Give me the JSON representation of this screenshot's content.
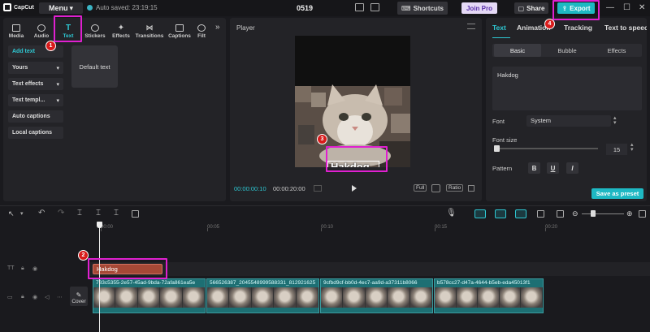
{
  "titlebar": {
    "logo": "CapCut",
    "menu_label": "Menu",
    "autosave": "Auto saved: 23:19:15",
    "project_name": "0519",
    "shortcuts_label": "Shortcuts",
    "join_pro_label": "Join Pro",
    "share_label": "Share",
    "export_label": "Export"
  },
  "left_panel": {
    "tabs": [
      {
        "label": "Media",
        "icon": "media-icon"
      },
      {
        "label": "Audio",
        "icon": "audio-icon"
      },
      {
        "label": "Text",
        "icon": "text-icon",
        "active": true
      },
      {
        "label": "Stickers",
        "icon": "stickers-icon"
      },
      {
        "label": "Effects",
        "icon": "effects-icon"
      },
      {
        "label": "Transitions",
        "icon": "transitions-icon"
      },
      {
        "label": "Captions",
        "icon": "captions-icon"
      },
      {
        "label": "Filt",
        "icon": "filters-icon"
      }
    ],
    "side_items": [
      {
        "label": "Add text",
        "active": true
      },
      {
        "label": "Yours",
        "has_dropdown": true
      },
      {
        "label": "Text effects",
        "has_dropdown": true
      },
      {
        "label": "Text templ...",
        "has_dropdown": true
      },
      {
        "label": "Auto captions"
      },
      {
        "label": "Local captions"
      }
    ],
    "default_text_card": "Default text"
  },
  "player": {
    "title": "Player",
    "overlay_text": "Hakdog",
    "current_time": "00:00:00:10",
    "total_time": "00:00:20:00",
    "full_label": "Full",
    "ratio_label": "Ratio"
  },
  "right_panel": {
    "tabs": [
      "Text",
      "Animation",
      "Tracking",
      "Text to speech"
    ],
    "subtabs": [
      "Basic",
      "Bubble",
      "Effects"
    ],
    "text_value": "Hakdog",
    "font_label": "Font",
    "font_value": "System",
    "font_size_label": "Font size",
    "font_size_value": "15",
    "pattern_label": "Pattern",
    "pattern_buttons": [
      "B",
      "U",
      "I"
    ],
    "save_preset_label": "Save as preset"
  },
  "timeline": {
    "ruler": [
      "00:00",
      "00:05",
      "00:10",
      "00:15",
      "00:20"
    ],
    "text_clip_label": "Hakdog",
    "cover_label": "Cover",
    "video_clips": [
      "783c5355-2e57-45ad-9bda-72afa861ea5e",
      "566526387_2045548999588331_812921625",
      "9cfbd9cf-bb0d-4ec7-aa9d-a37311b8066",
      "b578cc27-d47a-4644-b5eb-eda45013f1"
    ]
  },
  "annotations": [
    "1",
    "2",
    "3",
    "4"
  ],
  "colors": {
    "accent": "#1eb8c3",
    "highlight": "#e020d0",
    "badge": "#d81b1b",
    "text_clip": "#a64836"
  }
}
